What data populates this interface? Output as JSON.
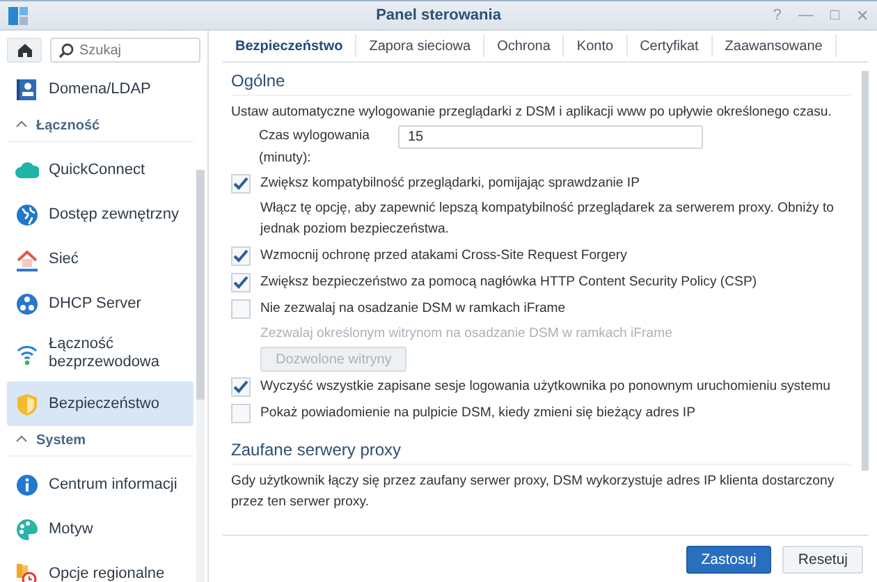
{
  "window": {
    "title": "Panel sterowania",
    "controls": [
      "?",
      "—",
      "□",
      "✕"
    ]
  },
  "sidebar": {
    "search": {
      "placeholder": "Szukaj"
    },
    "items": [
      {
        "kind": "item",
        "label": "Domena/LDAP",
        "selected": false
      },
      {
        "kind": "group",
        "label": "Łączność",
        "expanded": true
      },
      {
        "kind": "item",
        "label": "QuickConnect",
        "selected": false
      },
      {
        "kind": "item",
        "label": "Dostęp zewnętrzny",
        "selected": false
      },
      {
        "kind": "item",
        "label": "Sieć",
        "selected": false
      },
      {
        "kind": "item",
        "label": "DHCP Server",
        "selected": false
      },
      {
        "kind": "item",
        "label": "Łączność bezprzewodowa",
        "selected": false
      },
      {
        "kind": "item",
        "label": "Bezpieczeństwo",
        "selected": true
      },
      {
        "kind": "group",
        "label": "System",
        "expanded": true
      },
      {
        "kind": "item",
        "label": "Centrum informacji",
        "selected": false
      },
      {
        "kind": "item",
        "label": "Motyw",
        "selected": false
      },
      {
        "kind": "item",
        "label": "Opcje regionalne",
        "selected": false
      }
    ]
  },
  "tabs": [
    {
      "label": "Bezpieczeństwo",
      "selected": true
    },
    {
      "label": "Zapora sieciowa",
      "selected": false
    },
    {
      "label": "Ochrona",
      "selected": false
    },
    {
      "label": "Konto",
      "selected": false
    },
    {
      "label": "Certyfikat",
      "selected": false
    },
    {
      "label": "Zaawansowane",
      "selected": false
    }
  ],
  "sections": [
    {
      "title": "Ogólne",
      "rows": [
        {
          "kind": "text",
          "text": "Ustaw automatyczne wylogowanie przeglądarki z DSM i aplikacji www po upływie określonego czasu."
        },
        {
          "kind": "field",
          "label": "Czas wylogowania (minuty):",
          "value": "15"
        },
        {
          "kind": "checkbox",
          "label": "Zwiększ kompatybilność przeglądarki, pomijając sprawdzanie IP",
          "checked": true
        },
        {
          "kind": "note",
          "text": "Włącz tę opcję, aby zapewnić lepszą kompatybilność przeglądarek za serwerem proxy. Obniży to jednak poziom bezpieczeństwa.",
          "disabled": false
        },
        {
          "kind": "checkbox",
          "label": "Wzmocnij ochronę przed atakami Cross-Site Request Forgery",
          "checked": true
        },
        {
          "kind": "checkbox",
          "label": "Zwiększ bezpieczeństwo za pomocą nagłówka HTTP Content Security Policy (CSP)",
          "checked": true
        },
        {
          "kind": "checkbox",
          "label": "Nie zezwalaj na osadzanie DSM w ramkach iFrame",
          "checked": false
        },
        {
          "kind": "note",
          "text": "Zezwalaj określonym witrynom na osadzanie DSM w ramkach iFrame",
          "disabled": true
        },
        {
          "kind": "button",
          "label": "Dozwolone witryny",
          "disabled": true
        },
        {
          "kind": "checkbox",
          "label": "Wyczyść wszystkie zapisane sesje logowania użytkownika po ponownym uruchomieniu systemu",
          "checked": true
        },
        {
          "kind": "checkbox",
          "label": "Pokaż powiadomienie na pulpicie DSM, kiedy zmieni się bieżący adres IP",
          "checked": false
        }
      ]
    },
    {
      "title": "Zaufane serwery proxy",
      "rows": [
        {
          "kind": "text",
          "text": "Gdy użytkownik łączy się przez zaufany serwer proxy, DSM wykorzystuje adres IP klienta dostarczony przez ten serwer proxy."
        }
      ]
    }
  ],
  "footer": {
    "buttons": [
      {
        "label": "Zastosuj",
        "kind": "primary"
      },
      {
        "label": "Resetuj",
        "kind": "secondary"
      }
    ]
  }
}
